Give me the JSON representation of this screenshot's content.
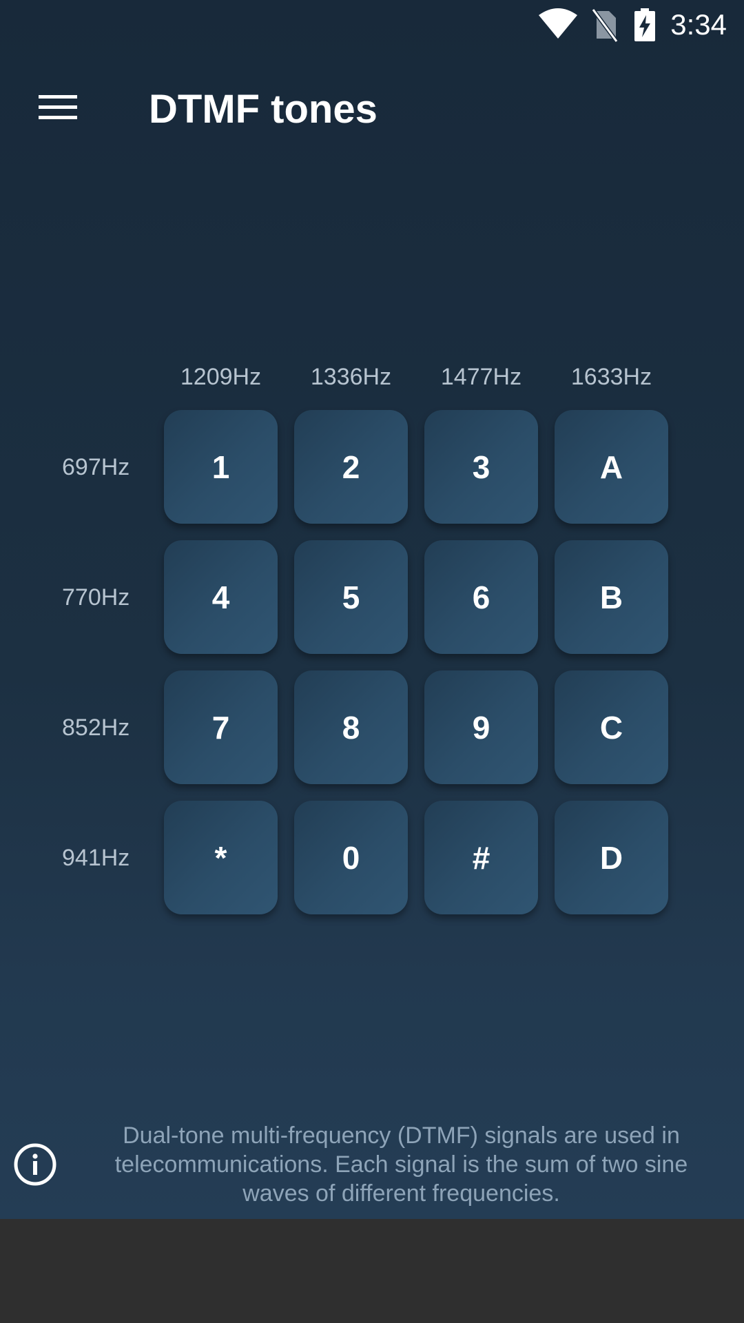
{
  "status_bar": {
    "time": "3:34",
    "icons": [
      "wifi-icon",
      "no-sim-icon",
      "battery-charging-icon"
    ]
  },
  "toolbar": {
    "menu_icon": "hamburger-menu-icon",
    "title": "DTMF tones"
  },
  "keypad": {
    "column_frequencies": [
      "1209Hz",
      "1336Hz",
      "1477Hz",
      "1633Hz"
    ],
    "row_frequencies": [
      "697Hz",
      "770Hz",
      "852Hz",
      "941Hz"
    ],
    "keys": [
      [
        "1",
        "2",
        "3",
        "A"
      ],
      [
        "4",
        "5",
        "6",
        "B"
      ],
      [
        "7",
        "8",
        "9",
        "C"
      ],
      [
        "*",
        "0",
        "#",
        "D"
      ]
    ]
  },
  "info": {
    "icon": "info-icon",
    "line1": "Dual-tone multi-frequency (DTMF) signals are used in",
    "line2": "telecommunications. Each signal is the sum of two sine",
    "line3": "waves of different frequencies."
  },
  "colors": {
    "background_top": "#18293a",
    "background_bottom": "#243d55",
    "key": "#2b4d68",
    "nav_area": "#2f2f2f"
  }
}
